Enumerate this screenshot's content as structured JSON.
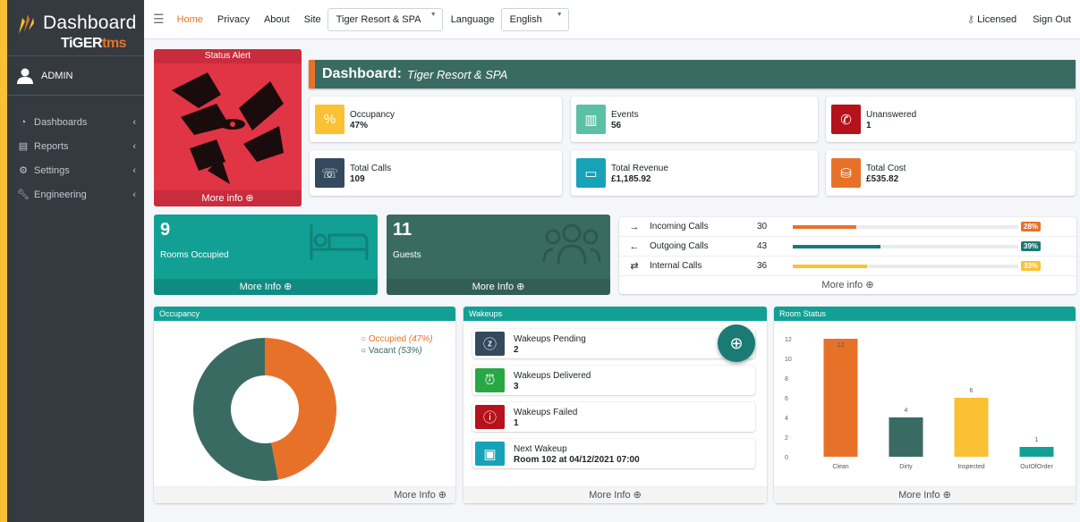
{
  "sidebar": {
    "brand_title": "Dashboard",
    "brand_sub_a": "TiGER",
    "brand_sub_b": "tms",
    "user": "ADMIN",
    "items": [
      {
        "label": "Dashboards",
        "icon": "dashboard-gauge-icon"
      },
      {
        "label": "Reports",
        "icon": "clipboard-icon"
      },
      {
        "label": "Settings",
        "icon": "gear-icon"
      },
      {
        "label": "Engineering",
        "icon": "wrench-icon"
      }
    ]
  },
  "topbar": {
    "home": "Home",
    "privacy": "Privacy",
    "about": "About",
    "site_label": "Site",
    "site_value": "Tiger Resort & SPA",
    "language_label": "Language",
    "language_value": "English",
    "licensed": "Licensed",
    "signout": "Sign Out"
  },
  "alert": {
    "title": "Status Alert",
    "more": "More info ⊕"
  },
  "header": {
    "title": "Dashboard:",
    "site": "Tiger Resort & SPA"
  },
  "stats": [
    {
      "label": "Occupancy",
      "value": "47%",
      "color": "#fbc134",
      "icon": "percent-icon"
    },
    {
      "label": "Events",
      "value": "56",
      "color": "#5bc0a6",
      "icon": "bar-chart-icon"
    },
    {
      "label": "Unanswered",
      "value": "1",
      "color": "#b5121b",
      "icon": "missed-call-icon"
    },
    {
      "label": "Total Calls",
      "value": "109",
      "color": "#34495e",
      "icon": "phone-icon"
    },
    {
      "label": "Total Revenue",
      "value": "£1,185.92",
      "color": "#17a2b8",
      "icon": "money-icon"
    },
    {
      "label": "Total Cost",
      "value": "£535.82",
      "color": "#e8712a",
      "icon": "coins-icon"
    }
  ],
  "rooms": {
    "value": "9",
    "label": "Rooms Occupied",
    "more": "More Info ⊕",
    "color": "#12a095"
  },
  "guests": {
    "value": "11",
    "label": "Guests",
    "more": "More Info ⊕",
    "color": "#3a6b63"
  },
  "calls": {
    "rows": [
      {
        "dir": "→",
        "label": "Incoming Calls",
        "count": "30",
        "pct": "28%",
        "fraction": 0.28,
        "color": "#e8712a"
      },
      {
        "dir": "←",
        "label": "Outgoing Calls",
        "count": "43",
        "pct": "39%",
        "fraction": 0.39,
        "color": "#1a7a74"
      },
      {
        "dir": "⇄",
        "label": "Internal Calls",
        "count": "36",
        "pct": "33%",
        "fraction": 0.33,
        "color": "#fbc134"
      }
    ],
    "more": "More info ⊕"
  },
  "occupancy": {
    "title": "Occupancy",
    "legend_occupied": "Occupied",
    "legend_occupied_pct": "(47%)",
    "legend_vacant": "Vacant",
    "legend_vacant_pct": "(53%)",
    "more": "More Info ⊕"
  },
  "wakeups": {
    "title": "Wakeups",
    "items": [
      {
        "label": "Wakeups Pending",
        "value": "2",
        "color": "#34495e",
        "icon": "snooze-icon"
      },
      {
        "label": "Wakeups Delivered",
        "value": "3",
        "color": "#28a745",
        "icon": "alarm-clock-icon"
      },
      {
        "label": "Wakeups Failed",
        "value": "1",
        "color": "#b5121b",
        "icon": "alarm-failed-icon"
      },
      {
        "label": "Next Wakeup",
        "value": "Room 102 at 04/12/2021 07:00",
        "color": "#17a2b8",
        "icon": "calendar-icon"
      }
    ],
    "more": "More Info ⊕"
  },
  "room_status": {
    "title": "Room Status",
    "more": "More Info ⊕"
  },
  "chart_data": [
    {
      "type": "pie",
      "categories": [
        "Occupied",
        "Vacant"
      ],
      "values": [
        47,
        53
      ],
      "colors": [
        "#e8712a",
        "#3a6b63"
      ],
      "title": "Occupancy"
    },
    {
      "type": "bar",
      "title": "Room Status",
      "categories": [
        "Clean",
        "Dirty",
        "Inspected",
        "OutOfOrder"
      ],
      "values": [
        12,
        4,
        6,
        1
      ],
      "colors": [
        "#e8712a",
        "#3a6b63",
        "#fbc134",
        "#12a095"
      ],
      "ylim": [
        0,
        12
      ],
      "yticks": [
        "0",
        "2",
        "4",
        "6",
        "8",
        "10",
        "12"
      ]
    }
  ]
}
